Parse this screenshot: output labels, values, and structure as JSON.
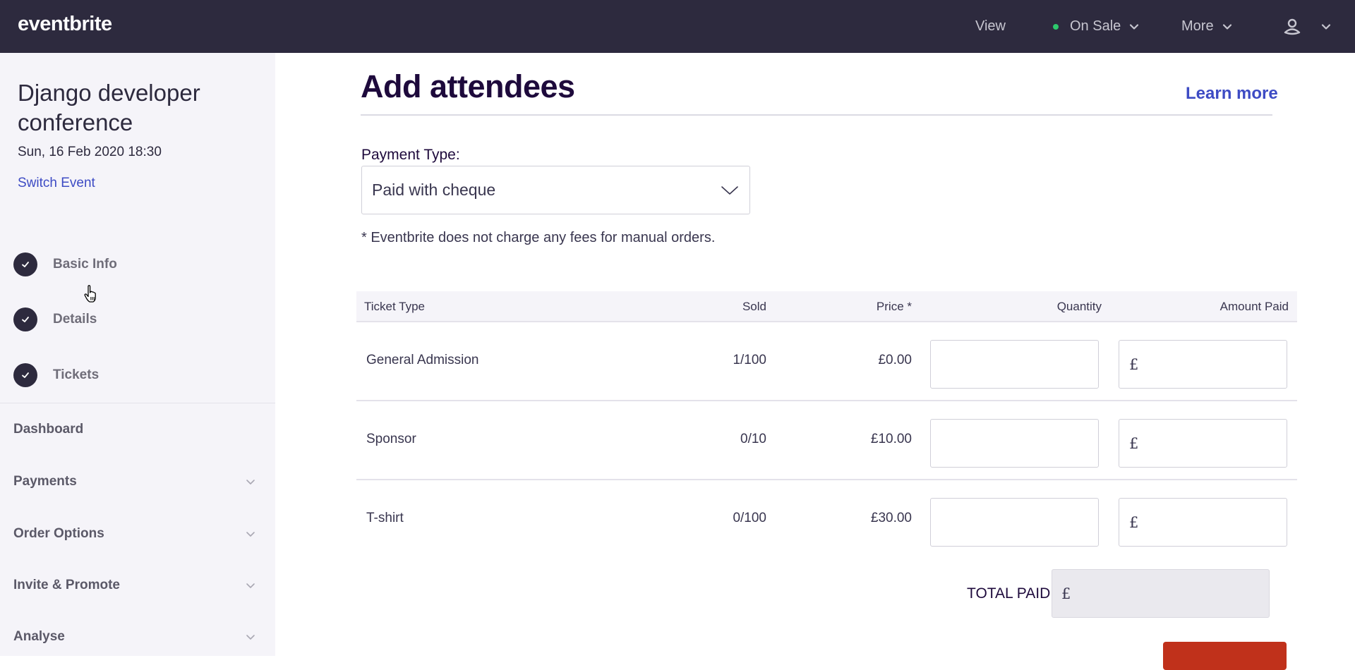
{
  "topbar": {
    "logo": "eventbrite",
    "nav": {
      "view": "View",
      "status": "On Sale",
      "status_color": "#2dc86c",
      "more": "More",
      "user_icon": "user-icon"
    }
  },
  "sidebar": {
    "event_title": "Django developer conference",
    "event_date": "Sun, 16 Feb 2020 18:30",
    "switch_event": "Switch Event",
    "steps": [
      {
        "label": "Basic Info",
        "completed": true
      },
      {
        "label": "Details",
        "completed": true
      },
      {
        "label": "Tickets",
        "completed": true
      }
    ],
    "menu": [
      {
        "label": "Dashboard",
        "expandable": false
      },
      {
        "label": "Payments",
        "expandable": true
      },
      {
        "label": "Order Options",
        "expandable": true
      },
      {
        "label": "Invite & Promote",
        "expandable": true
      },
      {
        "label": "Analyse",
        "expandable": true
      }
    ]
  },
  "main": {
    "title": "Add attendees",
    "learn_more": "Learn more",
    "payment_type_label": "Payment Type:",
    "payment_type_value": "Paid with cheque",
    "fee_note": "* Eventbrite does not charge any fees for manual orders.",
    "table": {
      "headers": {
        "ticket_type": "Ticket Type",
        "sold": "Sold",
        "price": "Price *",
        "quantity": "Quantity",
        "amount_paid": "Amount Paid"
      },
      "rows": [
        {
          "ticket_type": "General Admission",
          "sold": "1/100",
          "price": "£0.00",
          "quantity": "",
          "currency": "£",
          "amount_paid": ""
        },
        {
          "ticket_type": "Sponsor",
          "sold": "0/10",
          "price": "£10.00",
          "quantity": "",
          "currency": "£",
          "amount_paid": ""
        },
        {
          "ticket_type": "T-shirt",
          "sold": "0/100",
          "price": "£30.00",
          "quantity": "",
          "currency": "£",
          "amount_paid": ""
        }
      ]
    },
    "total_label": "TOTAL PAID",
    "total_currency": "£",
    "total_value": "",
    "accent_color": "#c0311b",
    "link_color": "#3d4bc4"
  }
}
